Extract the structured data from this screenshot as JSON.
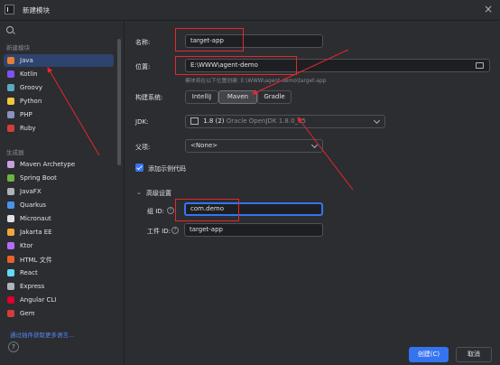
{
  "window": {
    "title": "新建模块"
  },
  "sidebar": {
    "section_new": "新建模块",
    "items_new": [
      {
        "label": "Java",
        "icon": "java-icon",
        "color": "#e57f33",
        "selected": true
      },
      {
        "label": "Kotlin",
        "icon": "kotlin-icon",
        "color": "#7f52ff"
      },
      {
        "label": "Groovy",
        "icon": "groovy-icon",
        "color": "#5aa9c6"
      },
      {
        "label": "Python",
        "icon": "python-icon",
        "color": "#f3c53d"
      },
      {
        "label": "PHP",
        "icon": "php-icon",
        "color": "#8892bf"
      },
      {
        "label": "Ruby",
        "icon": "ruby-icon",
        "color": "#d63b3b"
      }
    ],
    "section_gen": "生成器",
    "items_gen": [
      {
        "label": "Maven Archetype",
        "icon": "maven-icon",
        "color": "#c9a0dc"
      },
      {
        "label": "Spring Boot",
        "icon": "spring-icon",
        "color": "#6db33f"
      },
      {
        "label": "JavaFX",
        "icon": "javafx-icon",
        "color": "#aeb3bb"
      },
      {
        "label": "Quarkus",
        "icon": "quarkus-icon",
        "color": "#4695eb"
      },
      {
        "label": "Micronaut",
        "icon": "micronaut-icon",
        "color": "#dfe1e5"
      },
      {
        "label": "Jakarta EE",
        "icon": "jakarta-icon",
        "color": "#f3a53d"
      },
      {
        "label": "Ktor",
        "icon": "ktor-icon",
        "color": "#b66bff"
      },
      {
        "label": "HTML 文件",
        "icon": "html-icon",
        "color": "#e5622d"
      },
      {
        "label": "React",
        "icon": "react-icon",
        "color": "#61dafb"
      },
      {
        "label": "Express",
        "icon": "express-icon",
        "color": "#aeb3bb"
      },
      {
        "label": "Angular CLI",
        "icon": "angular-icon",
        "color": "#dd0031"
      },
      {
        "label": "Gem",
        "icon": "gem-icon",
        "color": "#d63b3b"
      }
    ],
    "plugin_link": "通过插件获取更多语言..."
  },
  "form": {
    "name_label": "名称:",
    "name_value": "target-app",
    "location_label": "位置:",
    "location_value": "E:\\WWW\\agent-demo",
    "location_hint": "模块将在以下位置创建: E:\\WWW\\agent-demo\\target-app",
    "build_label": "构建系统:",
    "build_options": [
      "IntelliJ",
      "Maven",
      "Gradle"
    ],
    "build_selected": "Maven",
    "jdk_label": "JDK:",
    "jdk_value": "1.8 (2)",
    "jdk_detail": "Oracle OpenJDK 1.8.0_65",
    "parent_label": "父项:",
    "parent_value": "<None>",
    "sample_label": "添加示例代码",
    "sample_checked": true,
    "advanced_label": "高级设置",
    "group_label": "组 ID:",
    "group_value": "com.demo",
    "artifact_label": "工件 ID:",
    "artifact_value": "target-app"
  },
  "footer": {
    "create_label": "创建(C)",
    "cancel_label": "取消",
    "help_label": "?"
  },
  "colors": {
    "accent": "#3574f0",
    "annotation": "#e5282d",
    "selection": "#2e436e"
  }
}
